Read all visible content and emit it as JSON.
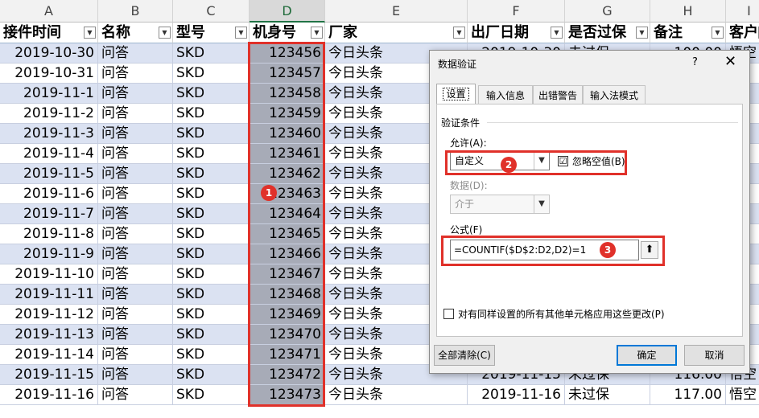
{
  "columns": [
    "A",
    "B",
    "C",
    "D",
    "E",
    "F",
    "G",
    "H",
    "I"
  ],
  "headers": [
    "接件时间",
    "名称",
    "型号",
    "机身号",
    "厂家",
    "出厂日期",
    "是否过保",
    "备注",
    "客户"
  ],
  "rows": [
    [
      "2019-10-30",
      "问答",
      "SKD",
      "123456",
      "今日头条",
      "2019-10-30",
      "未过保",
      "100.00",
      "悟空"
    ],
    [
      "2019-10-31",
      "问答",
      "SKD",
      "123457",
      "今日头条",
      "",
      "",
      "",
      ""
    ],
    [
      "2019-11-1",
      "问答",
      "SKD",
      "123458",
      "今日头条",
      "",
      "",
      "",
      ""
    ],
    [
      "2019-11-2",
      "问答",
      "SKD",
      "123459",
      "今日头条",
      "",
      "",
      "",
      ""
    ],
    [
      "2019-11-3",
      "问答",
      "SKD",
      "123460",
      "今日头条",
      "",
      "",
      "",
      ""
    ],
    [
      "2019-11-4",
      "问答",
      "SKD",
      "123461",
      "今日头条",
      "",
      "",
      "",
      ""
    ],
    [
      "2019-11-5",
      "问答",
      "SKD",
      "123462",
      "今日头条",
      "",
      "",
      "",
      ""
    ],
    [
      "2019-11-6",
      "问答",
      "SKD",
      "123463",
      "今日头条",
      "",
      "",
      "",
      ""
    ],
    [
      "2019-11-7",
      "问答",
      "SKD",
      "123464",
      "今日头条",
      "",
      "",
      "",
      ""
    ],
    [
      "2019-11-8",
      "问答",
      "SKD",
      "123465",
      "今日头条",
      "",
      "",
      "",
      ""
    ],
    [
      "2019-11-9",
      "问答",
      "SKD",
      "123466",
      "今日头条",
      "",
      "",
      "",
      ""
    ],
    [
      "2019-11-10",
      "问答",
      "SKD",
      "123467",
      "今日头条",
      "",
      "",
      "",
      ""
    ],
    [
      "2019-11-11",
      "问答",
      "SKD",
      "123468",
      "今日头条",
      "",
      "",
      "",
      ""
    ],
    [
      "2019-11-12",
      "问答",
      "SKD",
      "123469",
      "今日头条",
      "",
      "",
      "",
      ""
    ],
    [
      "2019-11-13",
      "问答",
      "SKD",
      "123470",
      "今日头条",
      "",
      "",
      "",
      ""
    ],
    [
      "2019-11-14",
      "问答",
      "SKD",
      "123471",
      "今日头条",
      "",
      "",
      "",
      ""
    ],
    [
      "2019-11-15",
      "问答",
      "SKD",
      "123472",
      "今日头条",
      "2019-11-15",
      "未过保",
      "116.00",
      "悟空"
    ],
    [
      "2019-11-16",
      "问答",
      "SKD",
      "123473",
      "今日头条",
      "2019-11-16",
      "未过保",
      "117.00",
      "悟空"
    ]
  ],
  "badges": [
    "1",
    "2",
    "3"
  ],
  "dialog": {
    "title": "数据验证",
    "help": "?",
    "close": "✕",
    "tabs": [
      "设置",
      "输入信息",
      "出错警告",
      "输入法模式"
    ],
    "criteria_label": "验证条件",
    "allow_label": "允许(A):",
    "allow_value": "自定义",
    "ignore_blank_label": "忽略空值(B)",
    "ignore_blank_checked": "☑",
    "data_label": "数据(D):",
    "data_value": "介于",
    "formula_label": "公式(F)",
    "formula_value": "=COUNTIF($D$2:D2,D2)=1",
    "apply_all_label": "对有同样设置的所有其他单元格应用这些更改(P)",
    "clear_all": "全部清除(C)",
    "ok": "确定",
    "cancel": "取消"
  },
  "colors": {
    "accent": "#e0312a",
    "band": "#dbe2f2",
    "selected": "#a7abb7",
    "focus": "#0078d7"
  }
}
